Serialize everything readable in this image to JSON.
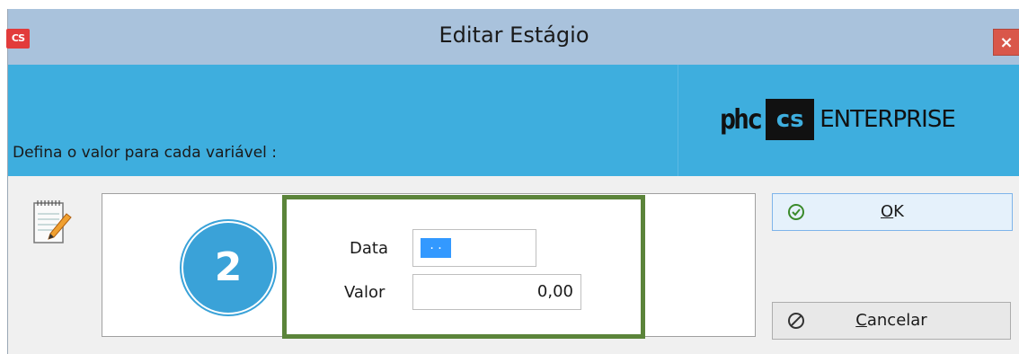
{
  "window": {
    "title": "Editar Estágio",
    "app_logo_text": "CS",
    "close_label": "×"
  },
  "header": {
    "instruction": "Defina o valor para cada variável :",
    "brand": {
      "phc": "phc",
      "cs": "cs",
      "enterprise": "ENTERPRISE"
    },
    "background_color": "#3eaede"
  },
  "step_badge": "2",
  "form": {
    "data_label": "Data",
    "data_value": ". .",
    "valor_label": "Valor",
    "valor_value": "0,00"
  },
  "buttons": {
    "ok_prefix": "",
    "ok_mnemonic": "O",
    "ok_rest": "K",
    "cancel_mnemonic": "C",
    "cancel_rest": "ancelar"
  },
  "icons": {
    "ok": "check-circle-icon",
    "cancel": "prohibited-icon",
    "notepad": "notepad-pencil-icon"
  },
  "colors": {
    "accent": "#3aa2d8",
    "highlight_frame": "#5b843a",
    "titlebar": "#a9c2dc"
  }
}
